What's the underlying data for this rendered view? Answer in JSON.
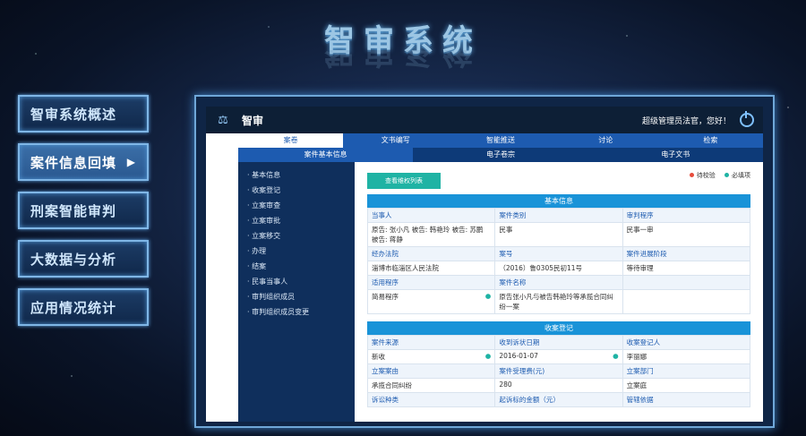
{
  "title": "智审系统",
  "nav": [
    {
      "label": "智审系统概述"
    },
    {
      "label": "案件信息回填",
      "arrow": "▶"
    },
    {
      "label": "刑案智能审判"
    },
    {
      "label": "大数据与分析"
    },
    {
      "label": "应用情况统计"
    }
  ],
  "app": {
    "name": "智审",
    "user": "超级管理员法官，您好！",
    "tabs1": [
      "案卷",
      "文书编写",
      "智能推送",
      "讨论",
      "检索"
    ],
    "tabs2": [
      "案件基本信息",
      "电子卷宗",
      "电子文书"
    ],
    "sidebar": [
      "基本信息",
      "收案登记",
      "立案审查",
      "立案审批",
      "立案移交",
      "办理",
      "结案",
      "民事当事人",
      "审判组织成员",
      "审判组织成员变更"
    ],
    "list_button": "查看维权列表",
    "legend": {
      "pending": "待校验",
      "required": "必填项"
    },
    "basic": {
      "title": "基本信息",
      "rows": [
        [
          {
            "l": "当事人",
            "v": "原告: 张小凡  被告: 韩艳玲  被告: 苏鹏  被告: 蒋静"
          },
          {
            "l": "案件类别",
            "v": "民事"
          },
          {
            "l": "审判程序",
            "v": "民事一审"
          }
        ],
        [
          {
            "l": "经办法院",
            "v": "淄博市临淄区人民法院"
          },
          {
            "l": "案号",
            "v": "（2016）鲁0305民初11号"
          },
          {
            "l": "案件进展阶段",
            "v": "等待审理"
          }
        ],
        [
          {
            "l": "适用程序",
            "v": "简易程序"
          },
          {
            "l": "案件名称",
            "v": "原告张小凡与被告韩艳玲等承揽合同纠纷一案"
          },
          {
            "l": "",
            "v": ""
          }
        ]
      ]
    },
    "register": {
      "title": "收案登记",
      "rows": [
        [
          {
            "l": "案件来源",
            "v": "新收"
          },
          {
            "l": "收到诉状日期",
            "v": "2016-01-07"
          },
          {
            "l": "收案登记人",
            "v": "李丽娜"
          }
        ],
        [
          {
            "l": "立案案由",
            "v": "承揽合同纠纷"
          },
          {
            "l": "案件受理费(元)",
            "v": "280"
          },
          {
            "l": "立案部门",
            "v": "立案庭"
          }
        ],
        [
          {
            "l": "诉讼种类",
            "v": ""
          },
          {
            "l": "起诉标的金额（元）",
            "v": ""
          },
          {
            "l": "管辖依据",
            "v": ""
          }
        ]
      ]
    }
  },
  "colors": {
    "accent": "#1993d8",
    "nav_border": "#7fb6e6",
    "teal": "#1fb3a4",
    "pending": "#e74c3c"
  }
}
